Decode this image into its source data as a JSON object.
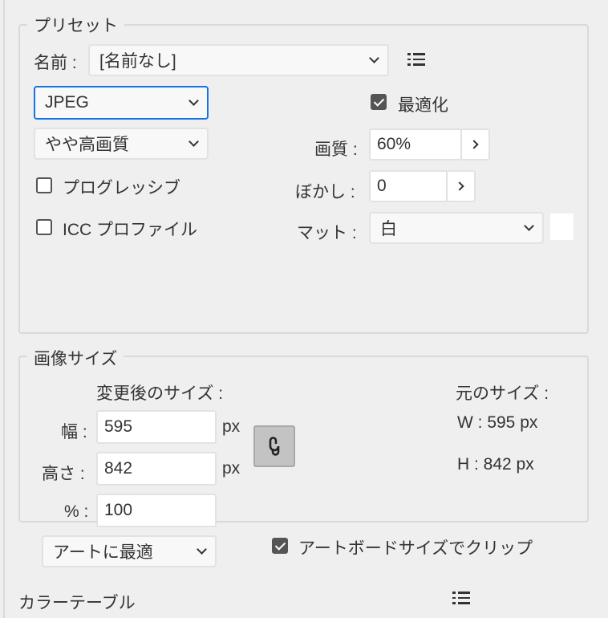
{
  "preset": {
    "title": "プリセット",
    "name_label": "名前 :",
    "name_value": "[名前なし]",
    "format": "JPEG",
    "quality_preset": "やや高画質",
    "optimize_label": "最適化",
    "optimize_checked": true,
    "quality_label": "画質 :",
    "quality_value": "60%",
    "blur_label": "ぼかし :",
    "blur_value": "0",
    "progressive_label": "プログレッシブ",
    "progressive_checked": false,
    "icc_label": "ICC プロファイル",
    "icc_checked": false,
    "matte_label": "マット :",
    "matte_value": "白",
    "matte_color": "#ffffff"
  },
  "image_size": {
    "title": "画像サイズ",
    "new_size_label": "変更後のサイズ :",
    "width_label": "幅 :",
    "width_value": "595",
    "height_label": "高さ :",
    "height_value": "842",
    "percent_label": "% :",
    "percent_value": "100",
    "unit": "px",
    "fit_option": "アートに最適",
    "original_label": "元のサイズ :",
    "orig_w": "W :  595 px",
    "orig_h": "H :  842 px",
    "clip_label": "アートボードサイズでクリップ",
    "clip_checked": true
  },
  "color_table": {
    "title": "カラーテーブル"
  }
}
